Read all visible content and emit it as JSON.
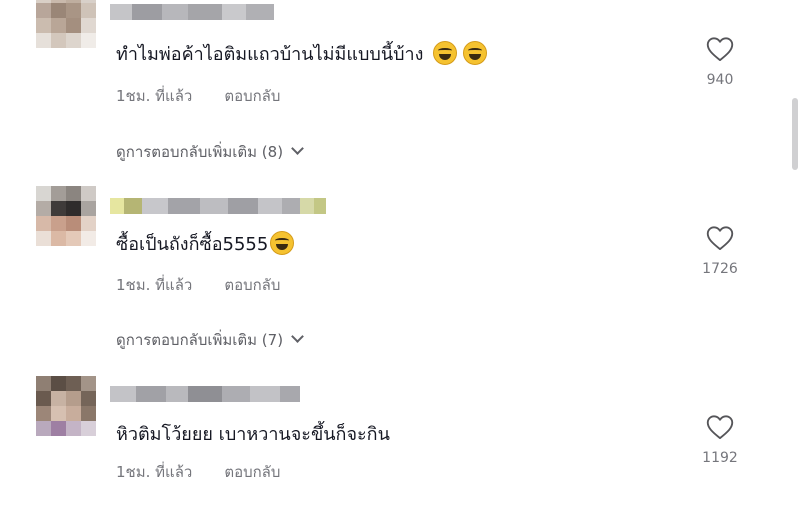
{
  "comments": [
    {
      "username": "",
      "text": "ทำไมพ่อค้าไอติมแถวบ้านไม่มีแบบนี้บ้าง",
      "emoji": [
        "grinning-sweat-emoji",
        "grinning-sweat-emoji"
      ],
      "time": "1ชม. ที่แล้ว",
      "reply_label": "ตอบกลับ",
      "likes": "940",
      "more_replies": "ดูการตอบกลับเพิ่มเติม (8)"
    },
    {
      "username": "",
      "text": "ซื้อเป็นถังก็ซื้อ5555",
      "emoji": [
        "grinning-sweat-emoji"
      ],
      "time": "1ชม. ที่แล้ว",
      "reply_label": "ตอบกลับ",
      "likes": "1726",
      "more_replies": "ดูการตอบกลับเพิ่มเติม (7)"
    },
    {
      "username": "",
      "text": "หิวติมโว้ยยย เบาหวานจะขึ้นก็จะกิน",
      "emoji": [],
      "time": "1ชม. ที่แล้ว",
      "reply_label": "ตอบกลับ",
      "likes": "1192"
    }
  ],
  "icons": {
    "like": "heart-outline-icon",
    "expand": "chevron-down-icon"
  },
  "colors": {
    "text": "#161823",
    "meta": "#75767c",
    "scroll_thumb": "#d0d0d2"
  }
}
